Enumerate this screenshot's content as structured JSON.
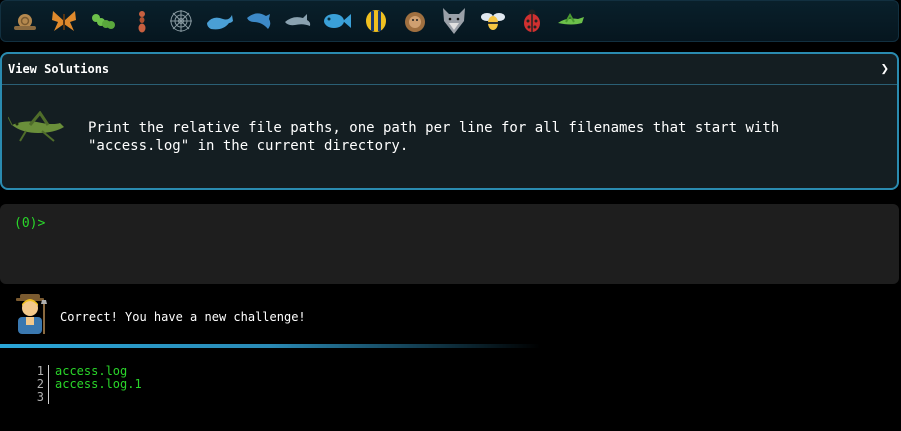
{
  "icon_bar": {
    "icons": [
      {
        "name": "snail-icon",
        "color": "#b5894f"
      },
      {
        "name": "butterfly-icon",
        "color": "#e08a2c"
      },
      {
        "name": "caterpillar-icon",
        "color": "#6cc04a"
      },
      {
        "name": "ant-icon",
        "color": "#c86040"
      },
      {
        "name": "spider-web-icon",
        "color": "#8899a0"
      },
      {
        "name": "whale-icon",
        "color": "#4a9fd5"
      },
      {
        "name": "dolphin-icon",
        "color": "#3d8ac8"
      },
      {
        "name": "dolphin-grey-icon",
        "color": "#8aa2b0"
      },
      {
        "name": "fish-icon",
        "color": "#3aa0d8"
      },
      {
        "name": "tropical-fish-icon",
        "color": "#f0c020"
      },
      {
        "name": "hedgehog-icon",
        "color": "#a07040"
      },
      {
        "name": "wolf-icon",
        "color": "#9aa0a8"
      },
      {
        "name": "bee-icon",
        "color": "#f5c542"
      },
      {
        "name": "ladybug-icon",
        "color": "#d03030"
      },
      {
        "name": "grasshopper-icon",
        "color": "#6cc04a"
      }
    ]
  },
  "challenge": {
    "title": "View Solutions",
    "chevron": "❯",
    "text": "Print the relative file paths, one path per line for all filenames that start with \"access.log\" in the current directory."
  },
  "terminal": {
    "prompt": "(0)>"
  },
  "feedback": {
    "message": "Correct! You have a new challenge!"
  },
  "output": {
    "lines": [
      {
        "number": "1",
        "text": "access.log"
      },
      {
        "number": "2",
        "text": "access.log.1"
      },
      {
        "number": "3",
        "text": ""
      }
    ]
  },
  "colors": {
    "accent": "#2a8bb0",
    "prompt_green": "#2ad62a",
    "panel_bg": "#141e22"
  }
}
